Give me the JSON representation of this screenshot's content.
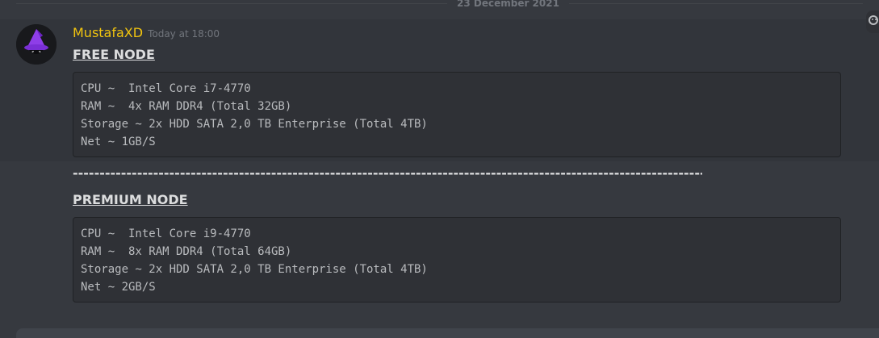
{
  "date_divider": "23 December 2021",
  "message": {
    "username": "MustafaXD",
    "timestamp": "Today at 18:00",
    "sections": [
      {
        "heading": "FREE NODE",
        "lines": [
          "CPU ~  Intel Core i7-4770",
          "RAM ~  4x RAM DDR4 (Total 32GB)",
          "Storage ~ 2x HDD SATA 2,0 TB Enterprise (Total 4TB)",
          "Net ~ 1GB/S"
        ]
      },
      {
        "heading": "PREMIUM NODE",
        "lines": [
          "CPU ~  Intel Core i9-4770",
          "RAM ~  8x RAM DDR4 (Total 64GB)",
          "Storage ~ 2x HDD SATA 2,0 TB Enterprise (Total 4TB)",
          "Net ~ 2GB/S"
        ]
      }
    ],
    "separator": "------------------------------------------------------------------------------------------------------------------------"
  },
  "colors": {
    "background": "#36393f",
    "username": "#f1c40f",
    "code_bg": "#2f3136",
    "text": "#dcddde",
    "muted": "#72767d"
  },
  "icons": {
    "avatar": "purple-wizard-hat-avatar",
    "reaction": "add-reaction-icon"
  }
}
